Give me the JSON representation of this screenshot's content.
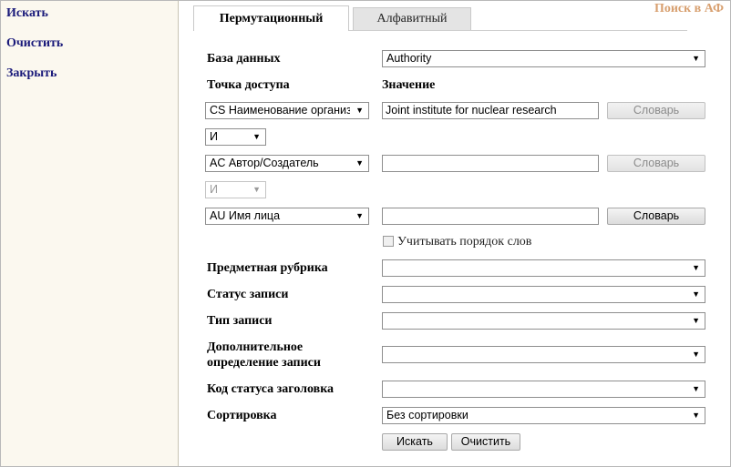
{
  "app_title": "Поиск в АФ",
  "sidebar": {
    "items": [
      {
        "label": "Искать"
      },
      {
        "label": "Очистить"
      },
      {
        "label": "Закрыть"
      }
    ]
  },
  "tabs": [
    {
      "label": "Пермутационный",
      "active": true
    },
    {
      "label": "Алфавитный",
      "active": false
    }
  ],
  "form": {
    "database_label": "База данных",
    "database_value": "Authority",
    "access_point_header": "Точка доступа",
    "value_header": "Значение",
    "rows": [
      {
        "field": "CS Наименование организации",
        "value": "Joint institute for nuclear research",
        "dict_label": "Словарь",
        "dict_enabled": false
      },
      {
        "field": "AC Автор/Создатель",
        "value": "",
        "dict_label": "Словарь",
        "dict_enabled": false
      },
      {
        "field": "AU Имя лица",
        "value": "",
        "dict_label": "Словарь",
        "dict_enabled": true
      }
    ],
    "operators": [
      {
        "value": "И",
        "enabled": true
      },
      {
        "value": "И",
        "enabled": false
      }
    ],
    "word_order_label": "Учитывать порядок слов",
    "word_order_checked": false,
    "subject_label": "Предметная рубрика",
    "subject_value": "",
    "record_status_label": "Статус записи",
    "record_status_value": "",
    "record_type_label": "Тип записи",
    "record_type_value": "",
    "extra_def_label_line1": "Дополнительное",
    "extra_def_label_line2": "определение записи",
    "extra_def_value": "",
    "heading_status_label": "Код статуса заголовка",
    "heading_status_value": "",
    "sort_label": "Сортировка",
    "sort_value": "Без сортировки",
    "search_button": "Искать",
    "clear_button": "Очистить"
  },
  "icons": {
    "dropdown_arrow": "▼"
  }
}
